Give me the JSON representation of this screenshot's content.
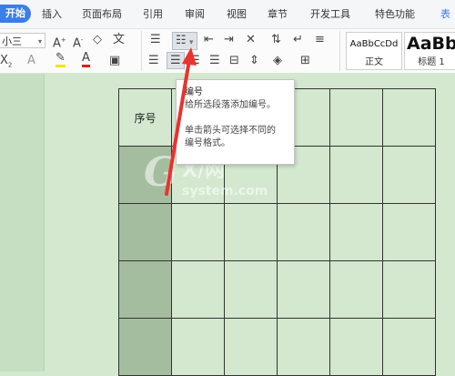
{
  "menubar": {
    "active_tab": "开始",
    "tabs": [
      "插入",
      "页面布局",
      "引用",
      "审阅",
      "视图",
      "章节",
      "开发工具",
      "特色功能",
      "表"
    ]
  },
  "ribbon": {
    "font_size_value": "小三",
    "style_cards": [
      {
        "sample": "AaBbCcDd",
        "name": "正文"
      },
      {
        "sample": "AaBb",
        "name": "标题 1"
      }
    ]
  },
  "table": {
    "header_cell": "序号"
  },
  "tooltip": {
    "title": "编号",
    "line1": "给所选段落添加编号。",
    "line2": "单击箭头可选择不同的",
    "line3": "编号格式。"
  },
  "watermark": {
    "logo": "G",
    "brand": "X/网",
    "site": "system.com"
  },
  "colors": {
    "accent": "#3b7de9",
    "page_bg": "#d3e8cf",
    "selected_cell": "#a4bd9f",
    "arrow": "#e8332e"
  }
}
